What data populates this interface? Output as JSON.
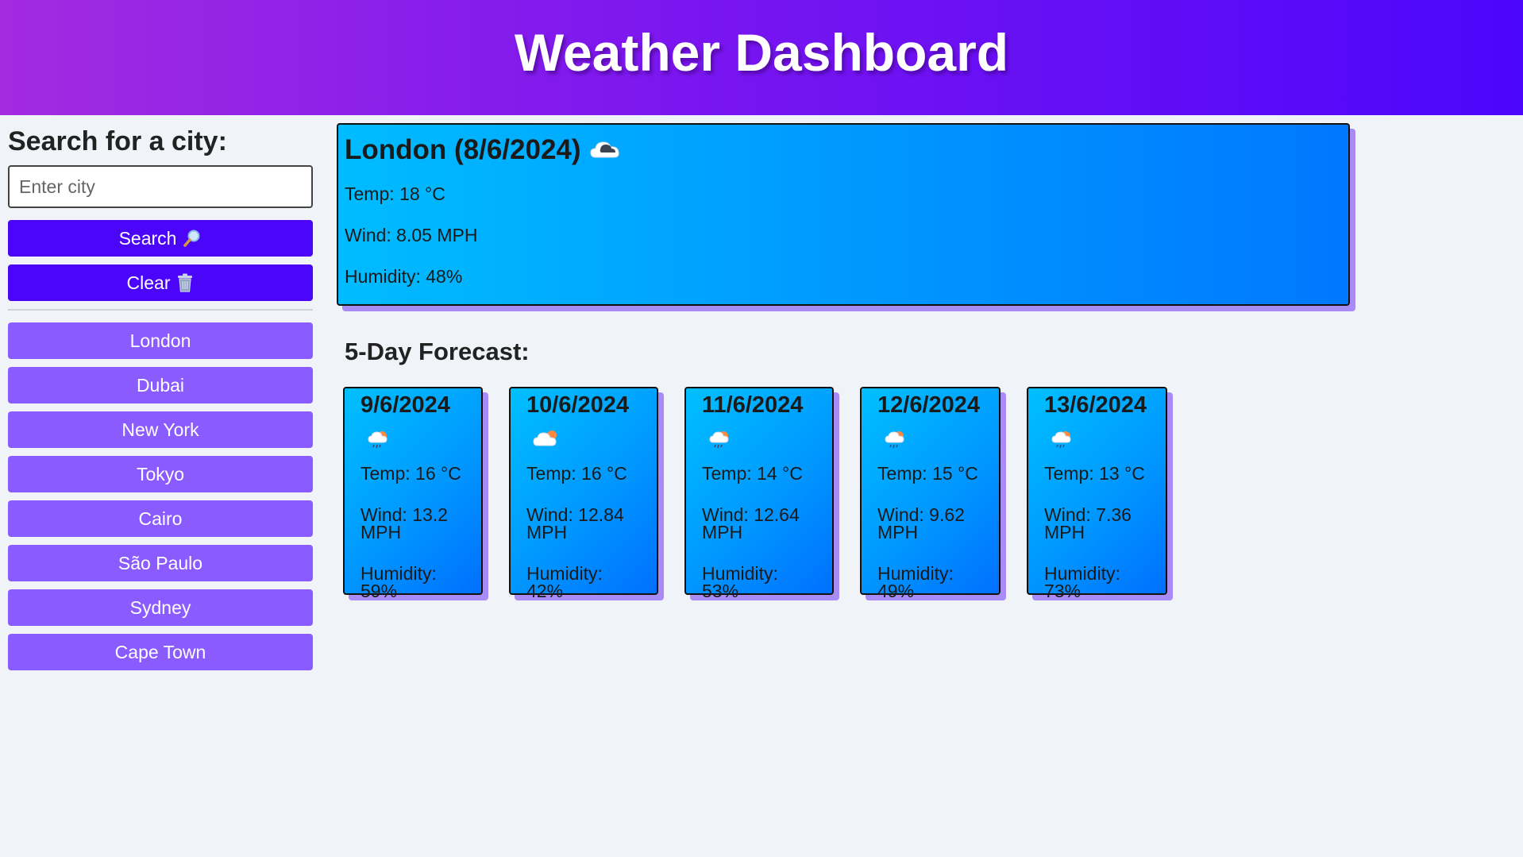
{
  "header": {
    "title": "Weather Dashboard"
  },
  "sidebar": {
    "heading": "Search for a city:",
    "search_placeholder": "Enter city",
    "search_label": "Search",
    "clear_label": "Clear",
    "history": [
      "London",
      "Dubai",
      "New York",
      "Tokyo",
      "Cairo",
      "São Paulo",
      "Sydney",
      "Cape Town"
    ]
  },
  "current": {
    "title": "London (8/6/2024)",
    "icon": "cloud-dark-icon",
    "temp": "Temp: 18 °C",
    "wind": "Wind: 8.05 MPH",
    "humidity": "Humidity: 48%"
  },
  "forecast": {
    "heading": "5-Day Forecast:",
    "days": [
      {
        "date": "9/6/2024",
        "icon": "rain-sun-icon",
        "temp": "Temp: 16 °C",
        "wind": "Wind: 13.2 MPH",
        "humidity": "Humidity: 59%"
      },
      {
        "date": "10/6/2024",
        "icon": "cloud-sun-icon",
        "temp": "Temp: 16 °C",
        "wind": "Wind: 12.84 MPH",
        "humidity": "Humidity: 42%"
      },
      {
        "date": "11/6/2024",
        "icon": "rain-sun-icon",
        "temp": "Temp: 14 °C",
        "wind": "Wind: 12.64 MPH",
        "humidity": "Humidity: 53%"
      },
      {
        "date": "12/6/2024",
        "icon": "rain-sun-icon",
        "temp": "Temp: 15 °C",
        "wind": "Wind: 9.62 MPH",
        "humidity": "Humidity: 49%"
      },
      {
        "date": "13/6/2024",
        "icon": "rain-sun-icon",
        "temp": "Temp: 13 °C",
        "wind": "Wind: 7.36 MPH",
        "humidity": "Humidity: 73%"
      }
    ]
  },
  "colors": {
    "header_start": "#a22be0",
    "header_end": "#4c06fb",
    "primary_button": "#4b06fa",
    "history_button": "#8a5bff",
    "card_start": "#00bcff",
    "card_end": "#0078ff",
    "card_shadow": "#a88bf5"
  }
}
